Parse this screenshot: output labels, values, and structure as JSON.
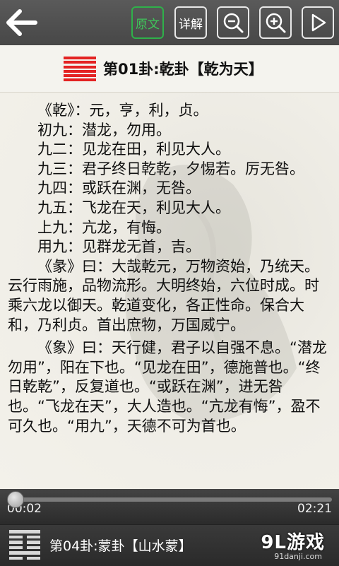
{
  "toolbar": {
    "original_label": "原文",
    "explain_label": "详解"
  },
  "hexagram_title": "第01卦:乾卦【乾为天】",
  "content": {
    "lines": [
      "《乾》：元，亨，利，贞。",
      "初九：潜龙，勿用。",
      "九二：见龙在田，利见大人。",
      "九三：君子终日乾乾，夕惕若。厉无咎。",
      "九四：或跃在渊，无咎。",
      "九五：飞龙在天，利见大人。",
      "上九：亢龙，有悔。",
      "用九：见群龙无首，吉。",
      "《彖》曰：大哉乾元，万物资始，乃统天。云行雨施，品物流形。大明终始，六位时成。时乘六龙以御天。乾道变化，各正性命。保合大和，乃利贞。首出庶物，万国威宁。",
      "《象》曰：天行健，君子以自强不息。“潜龙勿用”，阳在下也。“见龙在田”，德施普也。“终日乾乾”，反复道也。“或跃在渊”，进无咎也。“飞龙在天”，大人造也。“亢龙有悔”，盈不可久也。“用九”，天德不可为首也。"
    ]
  },
  "player": {
    "elapsed": "00:02",
    "duration": "02:21",
    "progress_fraction": 0.014
  },
  "next": {
    "title": "第04卦:蒙卦【山水蒙】"
  },
  "brand": {
    "name": "9L游戏",
    "url": "91danji.com"
  },
  "colors": {
    "accent_active": "#2fb14a",
    "hexagram_red": "#e32222",
    "toolbar_bg": "#4f4f4f"
  },
  "icons": {
    "back": "arrow-left-icon",
    "zoom_out": "zoom-out-icon",
    "zoom_in": "zoom-in-icon",
    "play": "play-icon"
  }
}
